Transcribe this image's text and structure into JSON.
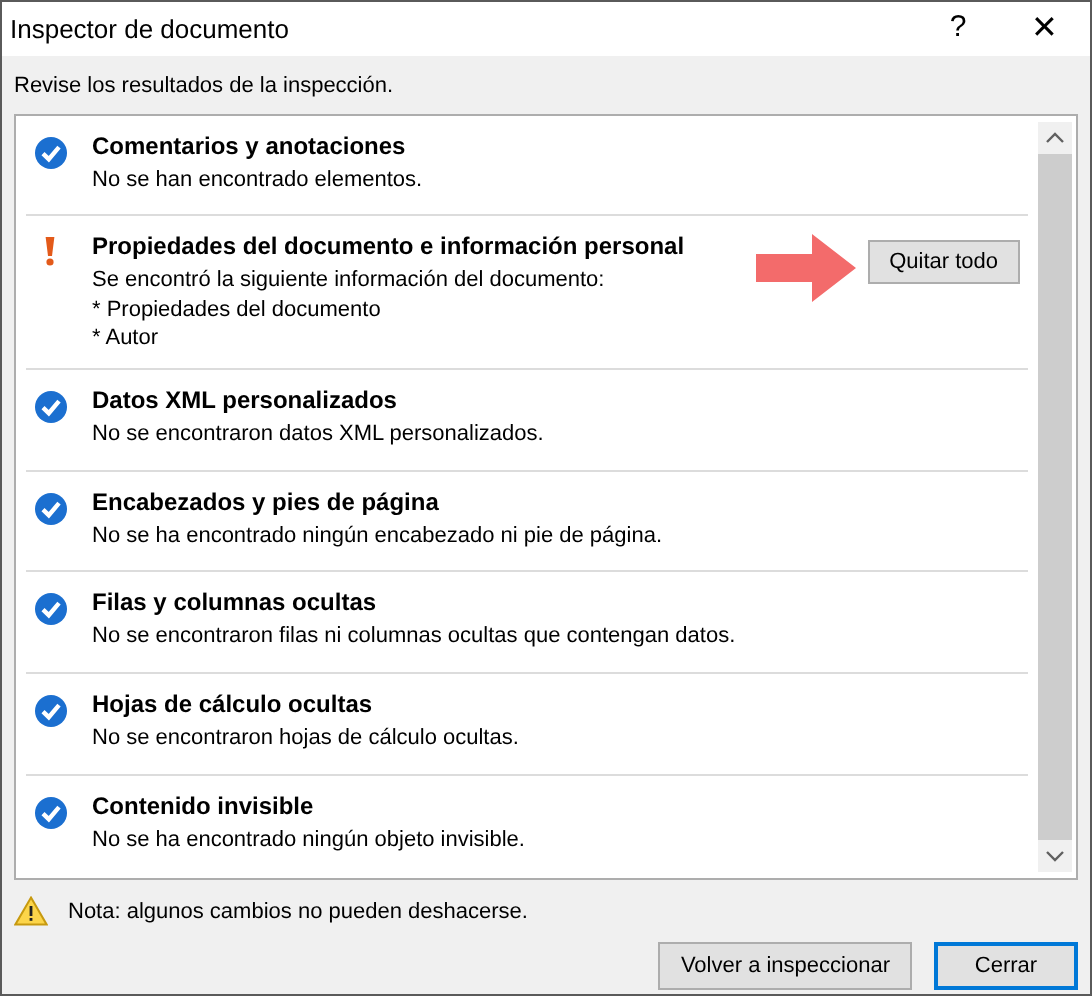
{
  "window": {
    "title": "Inspector de documento",
    "help": "?",
    "close": "✕"
  },
  "intro": "Revise los resultados de la inspección.",
  "results": [
    {
      "kind": "ok",
      "title": "Comentarios y anotaciones",
      "message": "No se han encontrado elementos."
    },
    {
      "kind": "found",
      "title": "Propiedades del documento e información personal",
      "message": "Se encontró la siguiente información del documento:",
      "details": [
        "* Propiedades del documento",
        "* Autor"
      ],
      "button": "Quitar todo"
    },
    {
      "kind": "ok",
      "title": "Datos XML personalizados",
      "message": "No se encontraron datos XML personalizados."
    },
    {
      "kind": "ok",
      "title": "Encabezados y pies de página",
      "message": "No se ha encontrado ningún encabezado ni pie de página."
    },
    {
      "kind": "ok",
      "title": "Filas y columnas ocultas",
      "message": "No se encontraron filas ni columnas ocultas que contengan datos."
    },
    {
      "kind": "ok",
      "title": "Hojas de cálculo ocultas",
      "message": "No se encontraron hojas de cálculo ocultas."
    },
    {
      "kind": "ok",
      "title": "Contenido invisible",
      "message": "No se ha encontrado ningún objeto invisible."
    }
  ],
  "note": "Nota: algunos cambios no pueden deshacerse.",
  "buttons": [
    {
      "label": "Volver a inspeccionar",
      "default": false
    },
    {
      "label": "Cerrar",
      "default": true
    }
  ]
}
